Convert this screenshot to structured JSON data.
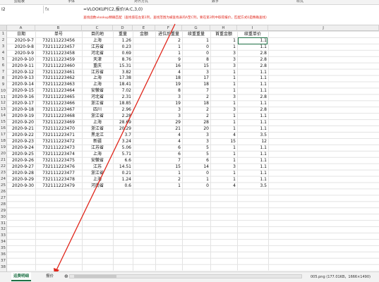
{
  "ribbon": {
    "groups": [
      "剪贴板",
      "字体",
      "对齐方式",
      "数字",
      "样式"
    ]
  },
  "formula_bar": {
    "name_box": "I2",
    "fx_label": "fx",
    "formula": "=VLOOKUP(C2,报价!A:C,3,0)",
    "note": "查找函数vlookup精确匹配（查找值在左第1列，查找范围为被查找表的A至C列，要在第3列中取得报价，匹配方式0是精确查找）"
  },
  "columns": [
    {
      "letter": "A",
      "header": "日期"
    },
    {
      "letter": "B",
      "header": "单号"
    },
    {
      "letter": "C",
      "header": "目的地"
    },
    {
      "letter": "D",
      "header": "重量"
    },
    {
      "letter": "E",
      "header": "金额"
    },
    {
      "letter": "F",
      "header": "进位后重量"
    },
    {
      "letter": "G",
      "header": "续重重量"
    },
    {
      "letter": "H",
      "header": "首重金额"
    },
    {
      "letter": "I",
      "header": "续重单价"
    }
  ],
  "rows": [
    [
      "2020-9-7",
      "732111223456",
      "上海",
      "1.26",
      "",
      "2",
      "1",
      "1",
      "1.1"
    ],
    [
      "2020-9-8",
      "732111223457",
      "江苏省",
      "0.23",
      "",
      "1",
      "0",
      "1",
      "1.1"
    ],
    [
      "2020-9-9",
      "732111223458",
      "河北省",
      "0.69",
      "",
      "1",
      "0",
      "3",
      "2.8"
    ],
    [
      "2020-9-10",
      "732111223459",
      "天津",
      "8.76",
      "",
      "9",
      "8",
      "3",
      "2.8"
    ],
    [
      "2020-9-11",
      "732111223460",
      "重庆",
      "15.31",
      "",
      "16",
      "15",
      "3",
      "2.8"
    ],
    [
      "2020-9-12",
      "732111223461",
      "江苏省",
      "3.82",
      "",
      "4",
      "3",
      "1",
      "1.1"
    ],
    [
      "2020-9-13",
      "732111223462",
      "上海",
      "17.38",
      "",
      "18",
      "17",
      "1",
      "1.1"
    ],
    [
      "2020-9-14",
      "732111223463",
      "上海",
      "18.41",
      "",
      "19",
      "18",
      "1",
      "1.1"
    ],
    [
      "2020-9-15",
      "732111223464",
      "安徽省",
      "7.02",
      "",
      "8",
      "7",
      "1",
      "1.1"
    ],
    [
      "2020-9-16",
      "732111223465",
      "河北省",
      "2.31",
      "",
      "3",
      "2",
      "3",
      "2.8"
    ],
    [
      "2020-9-17",
      "732111223466",
      "浙江省",
      "18.85",
      "",
      "19",
      "18",
      "1",
      "1.1"
    ],
    [
      "2020-9-18",
      "732111223467",
      "四川",
      "2.96",
      "",
      "3",
      "2",
      "3",
      "2.8"
    ],
    [
      "2020-9-19",
      "732111223468",
      "浙江省",
      "2.28",
      "",
      "3",
      "2",
      "1",
      "1.1"
    ],
    [
      "2020-9-20",
      "732111223469",
      "上海",
      "28.69",
      "",
      "29",
      "28",
      "1",
      "1.1"
    ],
    [
      "2020-9-21",
      "732111223470",
      "浙江省",
      "20.29",
      "",
      "21",
      "20",
      "1",
      "1.1"
    ],
    [
      "2020-9-22",
      "732111223471",
      "黑龙江",
      "3.7",
      "",
      "4",
      "3",
      "4",
      "3.5"
    ],
    [
      "2020-9-23",
      "732111223472",
      "新疆",
      "3.24",
      "",
      "4",
      "3",
      "15",
      "12"
    ],
    [
      "2020-9-24",
      "732111223473",
      "江苏省",
      "5.06",
      "",
      "6",
      "5",
      "1",
      "1.1"
    ],
    [
      "2020-9-25",
      "732111223474",
      "上海",
      "5.71",
      "",
      "6",
      "5",
      "1",
      "1.1"
    ],
    [
      "2020-9-26",
      "732111223475",
      "安徽省",
      "6.6",
      "",
      "7",
      "6",
      "1",
      "1.1"
    ],
    [
      "2020-9-27",
      "732111223476",
      "江苏",
      "14.51",
      "",
      "15",
      "14",
      "3",
      "1.1"
    ],
    [
      "2020-9-28",
      "732111223477",
      "浙江省",
      "0.21",
      "",
      "1",
      "0",
      "1",
      "1.1"
    ],
    [
      "2020-9-29",
      "732111223478",
      "上海",
      "1.24",
      "",
      "2",
      "1",
      "1",
      "1.1"
    ],
    [
      "2020-9-30",
      "732111223479",
      "河南省",
      "0.6",
      "",
      "1",
      "0",
      "4",
      "3.5"
    ]
  ],
  "row_numbers": [
    "1",
    "2",
    "3",
    "4",
    "5",
    "6",
    "7",
    "8",
    "9",
    "10",
    "11",
    "12",
    "13",
    "14",
    "15",
    "16",
    "17",
    "18",
    "19",
    "20",
    "21",
    "22",
    "23",
    "24",
    "25",
    "26",
    "27",
    "28",
    "29",
    "30",
    "31",
    "32",
    "33",
    "34",
    "35",
    "36",
    "37",
    "38",
    "39"
  ],
  "sheet_tabs": [
    {
      "label": "运费明细",
      "active": true,
      "color": "#1e7145"
    },
    {
      "label": "报价",
      "active": false
    }
  ],
  "add_sheet_icon": "plus-icon",
  "taskbar": {
    "file": "005.png (177.01KB，1666×1490)"
  },
  "colors": {
    "annotation": "#e0261b",
    "active_tab": "#1e7145"
  }
}
